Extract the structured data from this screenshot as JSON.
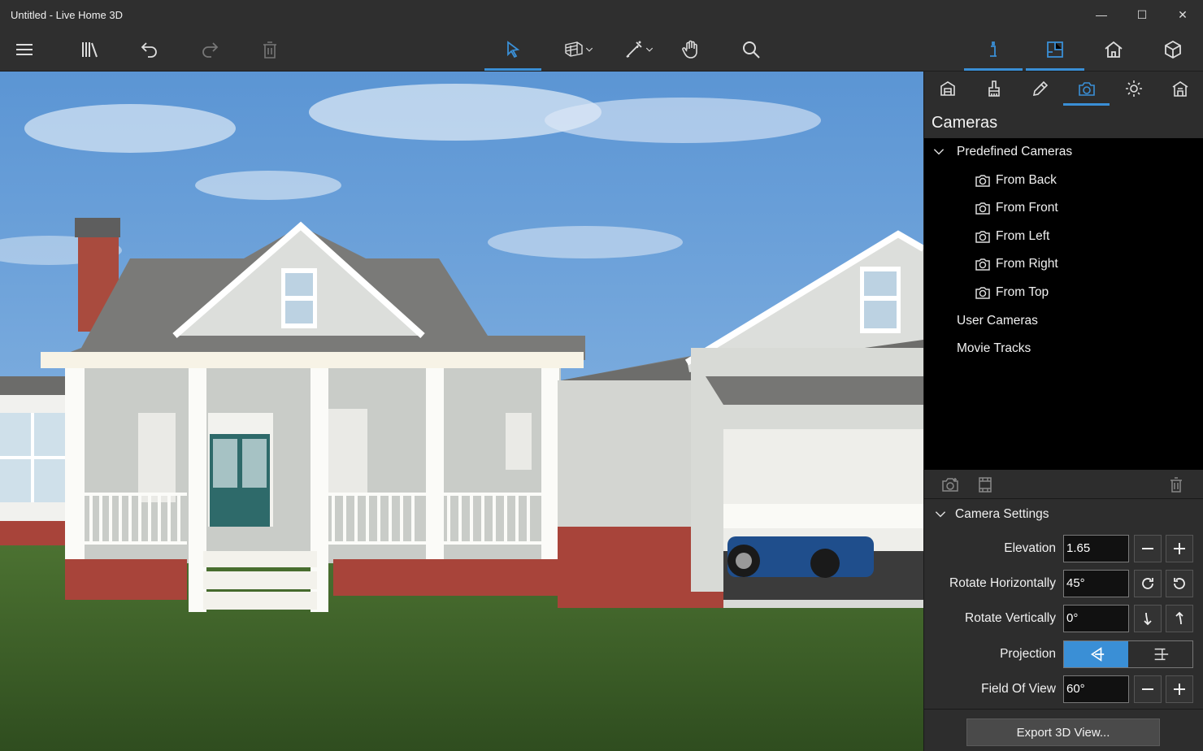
{
  "window": {
    "title": "Untitled - Live Home 3D",
    "minimize": "—",
    "maximize": "☐",
    "close": "✕"
  },
  "toolbar": {
    "accent": "#3a8fd6",
    "items": [
      "menu-icon",
      "library-icon",
      "undo-icon",
      "redo-icon",
      "trash-icon",
      "select-arrow-icon",
      "wall-tool-icon",
      "measure-tool-icon",
      "pan-hand-icon",
      "zoom-icon"
    ],
    "views": [
      "2d-plan-view-icon",
      "floor-plan-icon",
      "3d-house-view-icon",
      "3d-box-icon"
    ]
  },
  "panel": {
    "tabs": [
      "furniture-icon",
      "paint-brush-icon",
      "pencil-icon",
      "camera-icon",
      "sun-icon",
      "building-icon"
    ],
    "title": "Cameras",
    "tree": {
      "predefined_label": "Predefined Cameras",
      "cameras": [
        "From Back",
        "From Front",
        "From Left",
        "From Right",
        "From Top"
      ],
      "user_cameras": "User Cameras",
      "movie_tracks": "Movie Tracks"
    },
    "camera_settings": {
      "section_label": "Camera Settings",
      "elevation_label": "Elevation",
      "elevation_value": "1.65",
      "rot_h_label": "Rotate Horizontally",
      "rot_h_value": "45°",
      "rot_v_label": "Rotate Vertically",
      "rot_v_value": "0°",
      "projection_label": "Projection",
      "fov_label": "Field Of View",
      "fov_value": "60°"
    },
    "export_label": "Export 3D View..."
  }
}
